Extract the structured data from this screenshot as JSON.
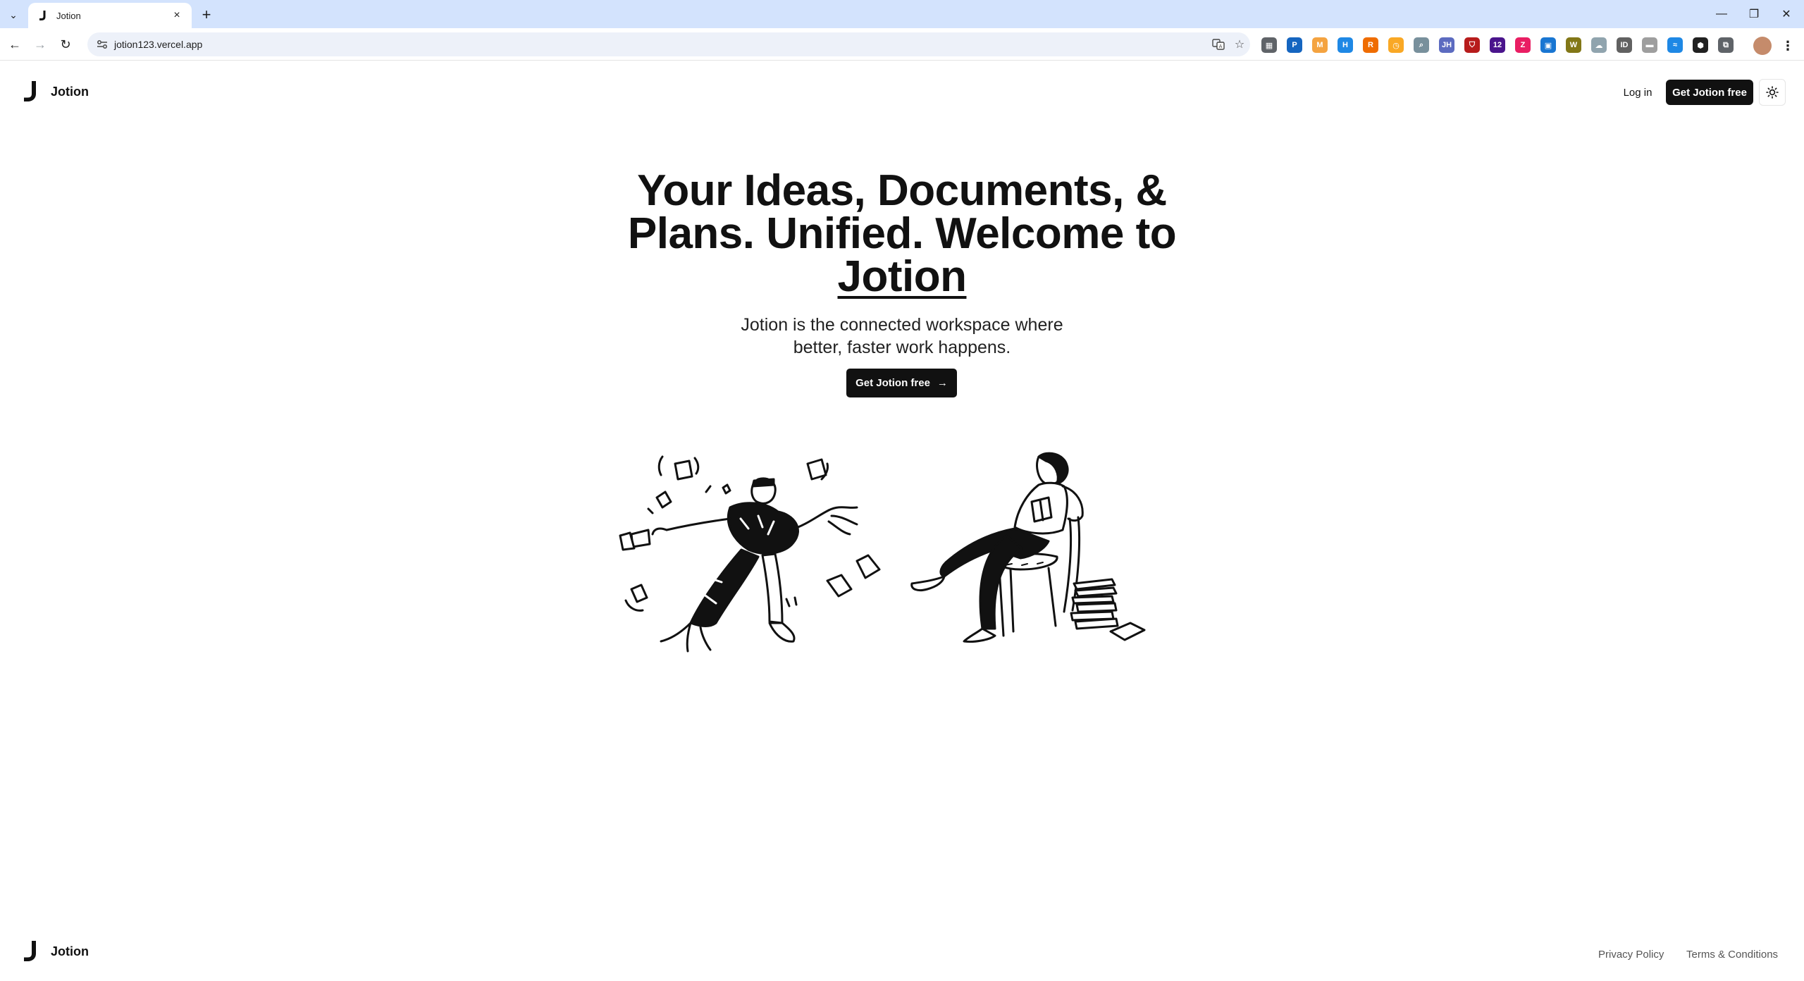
{
  "browser": {
    "tab_title": "Jotion",
    "new_tab_label": "+",
    "url": "jotion123.vercel.app",
    "extensions": [
      {
        "name": "extension-store-icon",
        "glyph": "▦",
        "color": "#5f6368"
      },
      {
        "name": "extension-paypal-icon",
        "glyph": "P",
        "color": "#1565c0"
      },
      {
        "name": "extension-mail-icon",
        "glyph": "M",
        "color": "#f4a340"
      },
      {
        "name": "extension-h-icon",
        "glyph": "H",
        "color": "#1e88e5"
      },
      {
        "name": "extension-r-icon",
        "glyph": "R",
        "color": "#ef6c00"
      },
      {
        "name": "extension-clock-icon",
        "glyph": "◷",
        "color": "#f9a825"
      },
      {
        "name": "extension-search-icon",
        "glyph": "⌕",
        "color": "#78909c"
      },
      {
        "name": "extension-jh-icon",
        "glyph": "JH",
        "color": "#5c6bc0"
      },
      {
        "name": "extension-shield-icon",
        "glyph": "⛉",
        "color": "#b71c1c"
      },
      {
        "name": "extension-badge-icon",
        "glyph": "12",
        "color": "#4a148c"
      },
      {
        "name": "extension-zx-icon",
        "glyph": "Z",
        "color": "#e91e63"
      },
      {
        "name": "extension-image-icon",
        "glyph": "▣",
        "color": "#1976d2"
      },
      {
        "name": "extension-w-icon",
        "glyph": "W",
        "color": "#827717"
      },
      {
        "name": "extension-cloud-icon",
        "glyph": "☁",
        "color": "#90a4ae"
      },
      {
        "name": "extension-id-icon",
        "glyph": "ID",
        "color": "#616161"
      },
      {
        "name": "extension-gray-icon",
        "glyph": "▬",
        "color": "#9e9e9e"
      },
      {
        "name": "extension-wave-icon",
        "glyph": "≈",
        "color": "#1e88e5"
      },
      {
        "name": "extension-cube-icon",
        "glyph": "⬢",
        "color": "#212121"
      },
      {
        "name": "extensions-puzzle-icon",
        "glyph": "⧉",
        "color": "#5f6368"
      }
    ]
  },
  "nav": {
    "logo_text": "Jotion",
    "login_label": "Log in",
    "cta_label": "Get Jotion free"
  },
  "hero": {
    "title_main": "Your Ideas, Documents, & Plans. Unified. Welcome to ",
    "title_brand": "Jotion",
    "subtitle": "Jotion is the connected workspace where better, faster work happens.",
    "cta_label": "Get Jotion free",
    "cta_arrow": "→"
  },
  "footer": {
    "logo_text": "Jotion",
    "privacy_label": "Privacy Policy",
    "terms_label": "Terms & Conditions"
  }
}
